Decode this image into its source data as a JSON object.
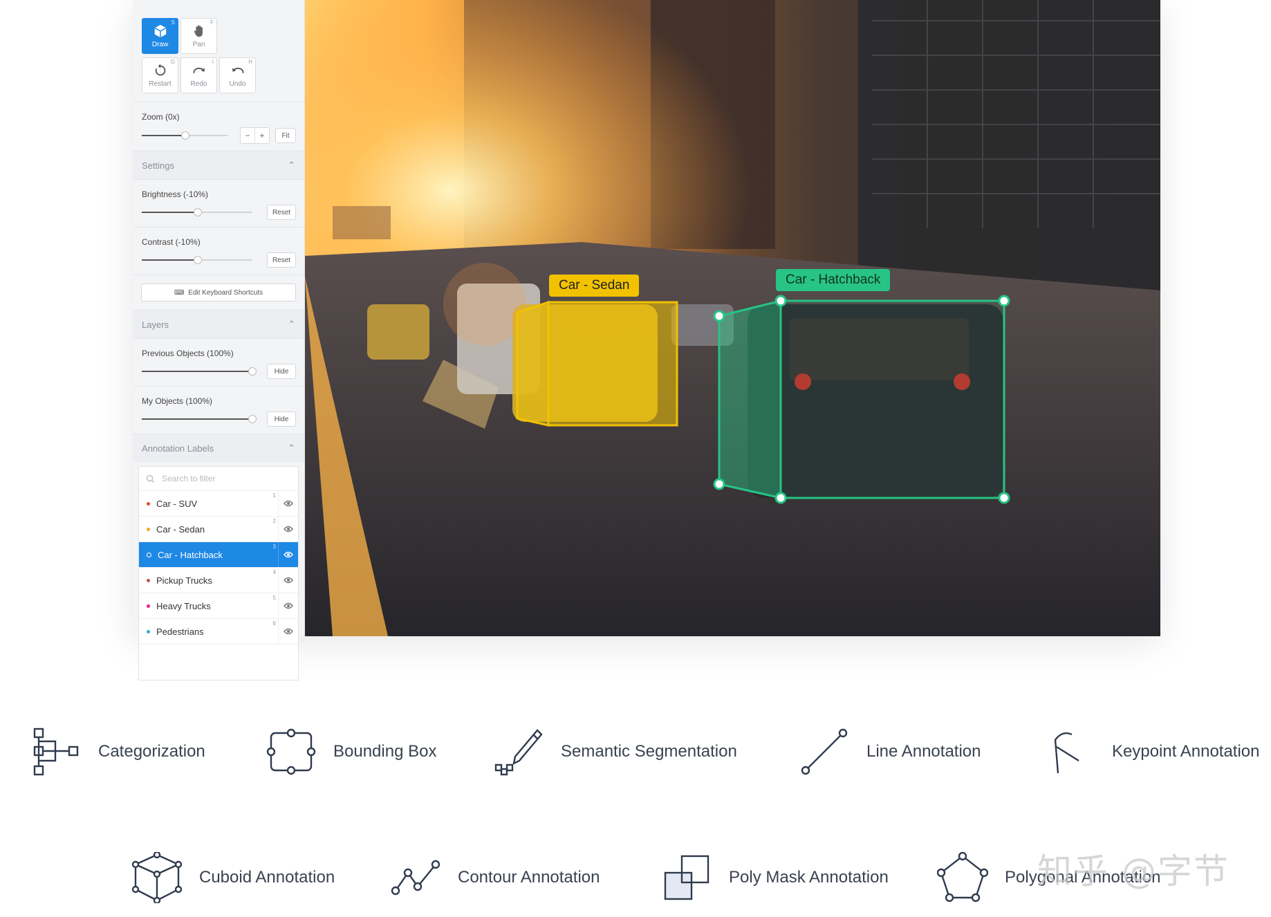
{
  "toolbar": {
    "draw": {
      "label": "Draw",
      "key": "S"
    },
    "pan": {
      "label": "Pan",
      "key": "F"
    },
    "restart": {
      "label": "Restart",
      "key": "G"
    },
    "redo": {
      "label": "Redo",
      "key": "I"
    },
    "undo": {
      "label": "Undo",
      "key": "H"
    }
  },
  "zoom": {
    "label": "Zoom (0x)",
    "minus": "−",
    "plus": "+",
    "fit": "Fit",
    "level": 0.5
  },
  "settings": {
    "title": "Settings",
    "brightness": {
      "label": "Brightness (-10%)",
      "reset": "Reset",
      "level": 0.5
    },
    "contrast": {
      "label": "Contrast (-10%)",
      "reset": "Reset",
      "level": 0.5
    },
    "shortcuts": "Edit Keyboard Shortcuts"
  },
  "layers": {
    "title": "Layers",
    "previous": {
      "label": "Previous Objects (100%)",
      "button": "Hide",
      "level": 1.0
    },
    "mine": {
      "label": "My Objects (100%)",
      "button": "Hide",
      "level": 1.0
    }
  },
  "annotation_labels": {
    "title": "Annotation Labels",
    "search_placeholder": "Search to filter",
    "items": [
      {
        "name": "Car - SUV",
        "index": "1",
        "color": "#e8501c"
      },
      {
        "name": "Car - Sedan",
        "index": "2",
        "color": "#f5a623"
      },
      {
        "name": "Car - Hatchback",
        "index": "3",
        "color": "#1de9b6"
      },
      {
        "name": "Pickup Trucks",
        "index": "4",
        "color": "#c0504d"
      },
      {
        "name": "Heavy Trucks",
        "index": "5",
        "color": "#e91e8c"
      },
      {
        "name": "Pedestrians",
        "index": "6",
        "color": "#29a8e0"
      }
    ]
  },
  "canvas": {
    "sedan_tag": "Car - Sedan",
    "hatchback_tag": "Car - Hatchback",
    "sedan_color": "#f2c200",
    "hatchback_color": "#27c485"
  },
  "features": [
    {
      "label": "Categorization",
      "icon": "hierarchy-icon"
    },
    {
      "label": "Bounding Box",
      "icon": "bounding-box-icon"
    },
    {
      "label": "Semantic Segmentation",
      "icon": "pencil-icon"
    },
    {
      "label": "Line Annotation",
      "icon": "line-icon"
    },
    {
      "label": "Keypoint Annotation",
      "icon": "keypoint-icon"
    },
    {
      "label": "Cuboid Annotation",
      "icon": "cuboid-icon"
    },
    {
      "label": "Contour Annotation",
      "icon": "contour-icon"
    },
    {
      "label": "Poly Mask Annotation",
      "icon": "poly-mask-icon"
    },
    {
      "label": "Polygonal Annotation",
      "icon": "polygon-icon"
    }
  ],
  "watermark": "知乎 @字节",
  "colors": {
    "accent": "#1e88e5",
    "icon_stroke": "#2f3a4c"
  }
}
